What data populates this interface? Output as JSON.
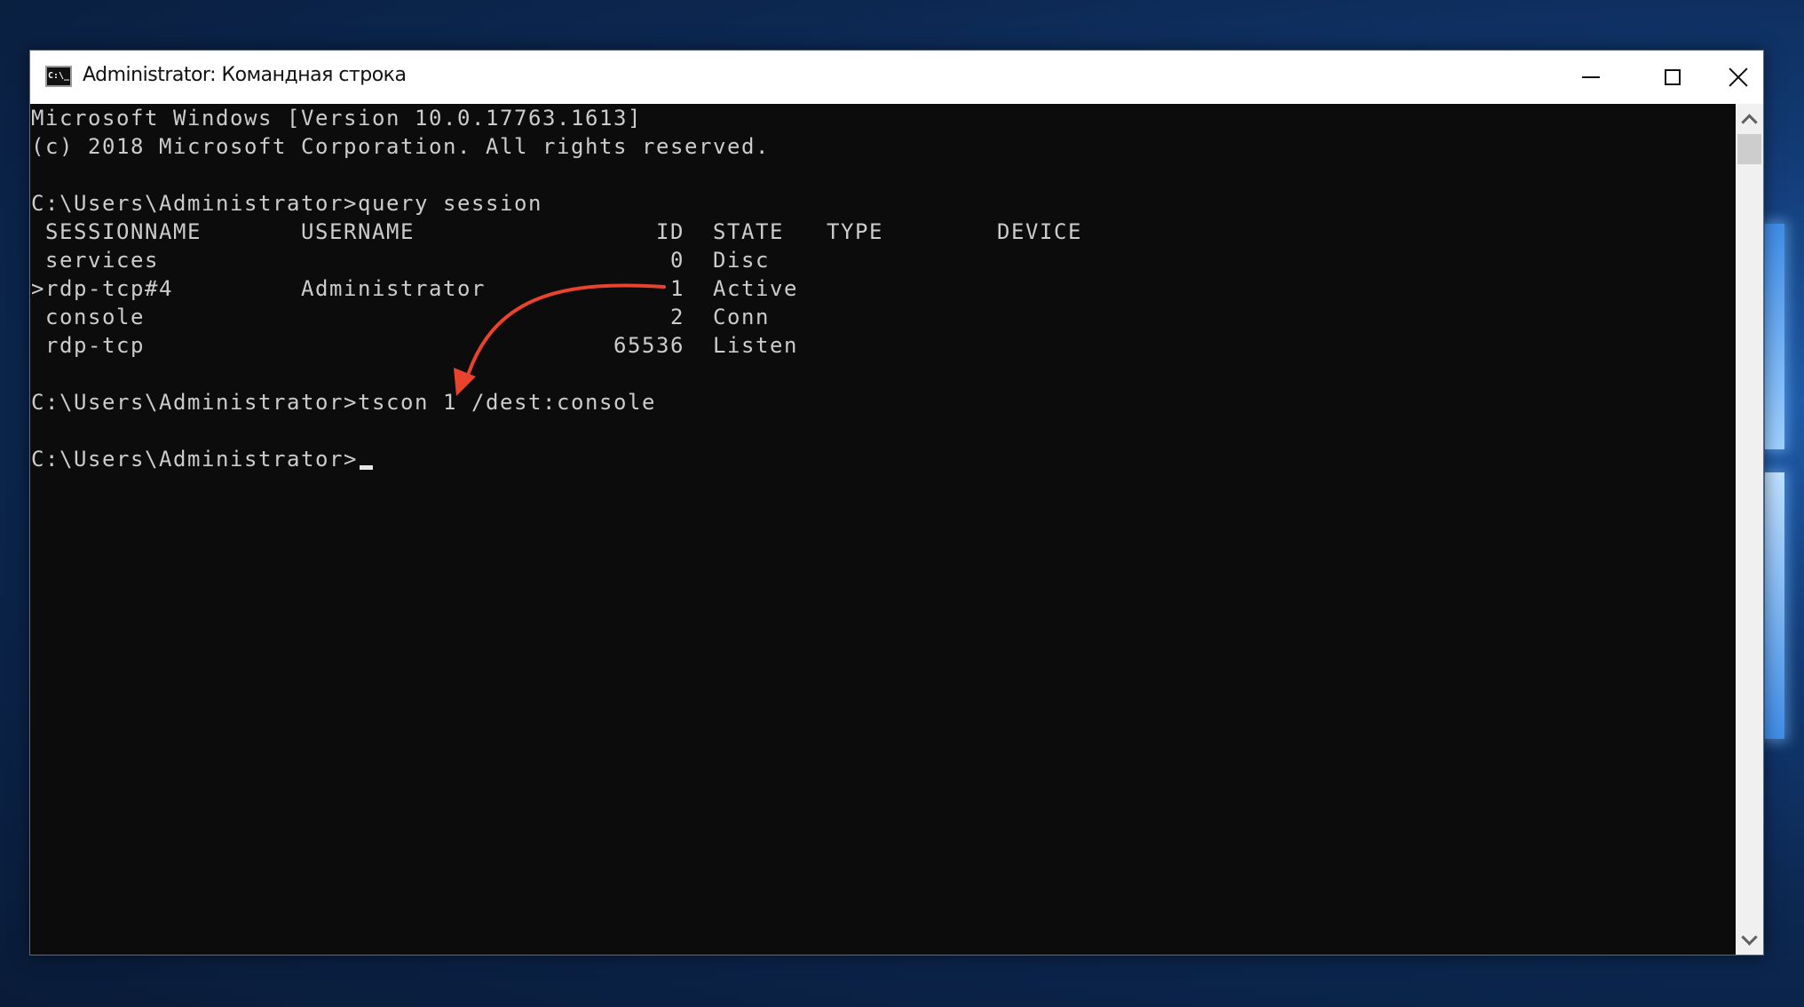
{
  "window": {
    "title": "Administrator: Командная строка",
    "icon_label": "C:\\_",
    "controls": {
      "minimize": "minimize",
      "maximize": "maximize",
      "close": "close"
    }
  },
  "console": {
    "lines": [
      "Microsoft Windows [Version 10.0.17763.1613]",
      "(c) 2018 Microsoft Corporation. All rights reserved.",
      "",
      "C:\\Users\\Administrator>query session",
      " SESSIONNAME       USERNAME                 ID  STATE   TYPE        DEVICE",
      " services                                    0  Disc",
      ">rdp-tcp#4         Administrator             1  Active",
      " console                                     2  Conn",
      " rdp-tcp                                 65536  Listen",
      "",
      "C:\\Users\\Administrator>tscon 1 /dest:console",
      "",
      "C:\\Users\\Administrator>"
    ],
    "session_table": {
      "headers": [
        "SESSIONNAME",
        "USERNAME",
        "ID",
        "STATE",
        "TYPE",
        "DEVICE"
      ],
      "rows": [
        {
          "sessionname": "services",
          "username": "",
          "id": "0",
          "state": "Disc",
          "current": false
        },
        {
          "sessionname": "rdp-tcp#4",
          "username": "Administrator",
          "id": "1",
          "state": "Active",
          "current": true
        },
        {
          "sessionname": "console",
          "username": "",
          "id": "2",
          "state": "Conn",
          "current": false
        },
        {
          "sessionname": "rdp-tcp",
          "username": "",
          "id": "65536",
          "state": "Listen",
          "current": false
        }
      ]
    },
    "prompt": "C:\\Users\\Administrator>",
    "commands": [
      "query session",
      "tscon 1 /dest:console"
    ]
  },
  "annotation": {
    "type": "arrow",
    "from": "session ID 1 (Active)",
    "to": "tscon argument 1",
    "color": "#e8432f"
  }
}
